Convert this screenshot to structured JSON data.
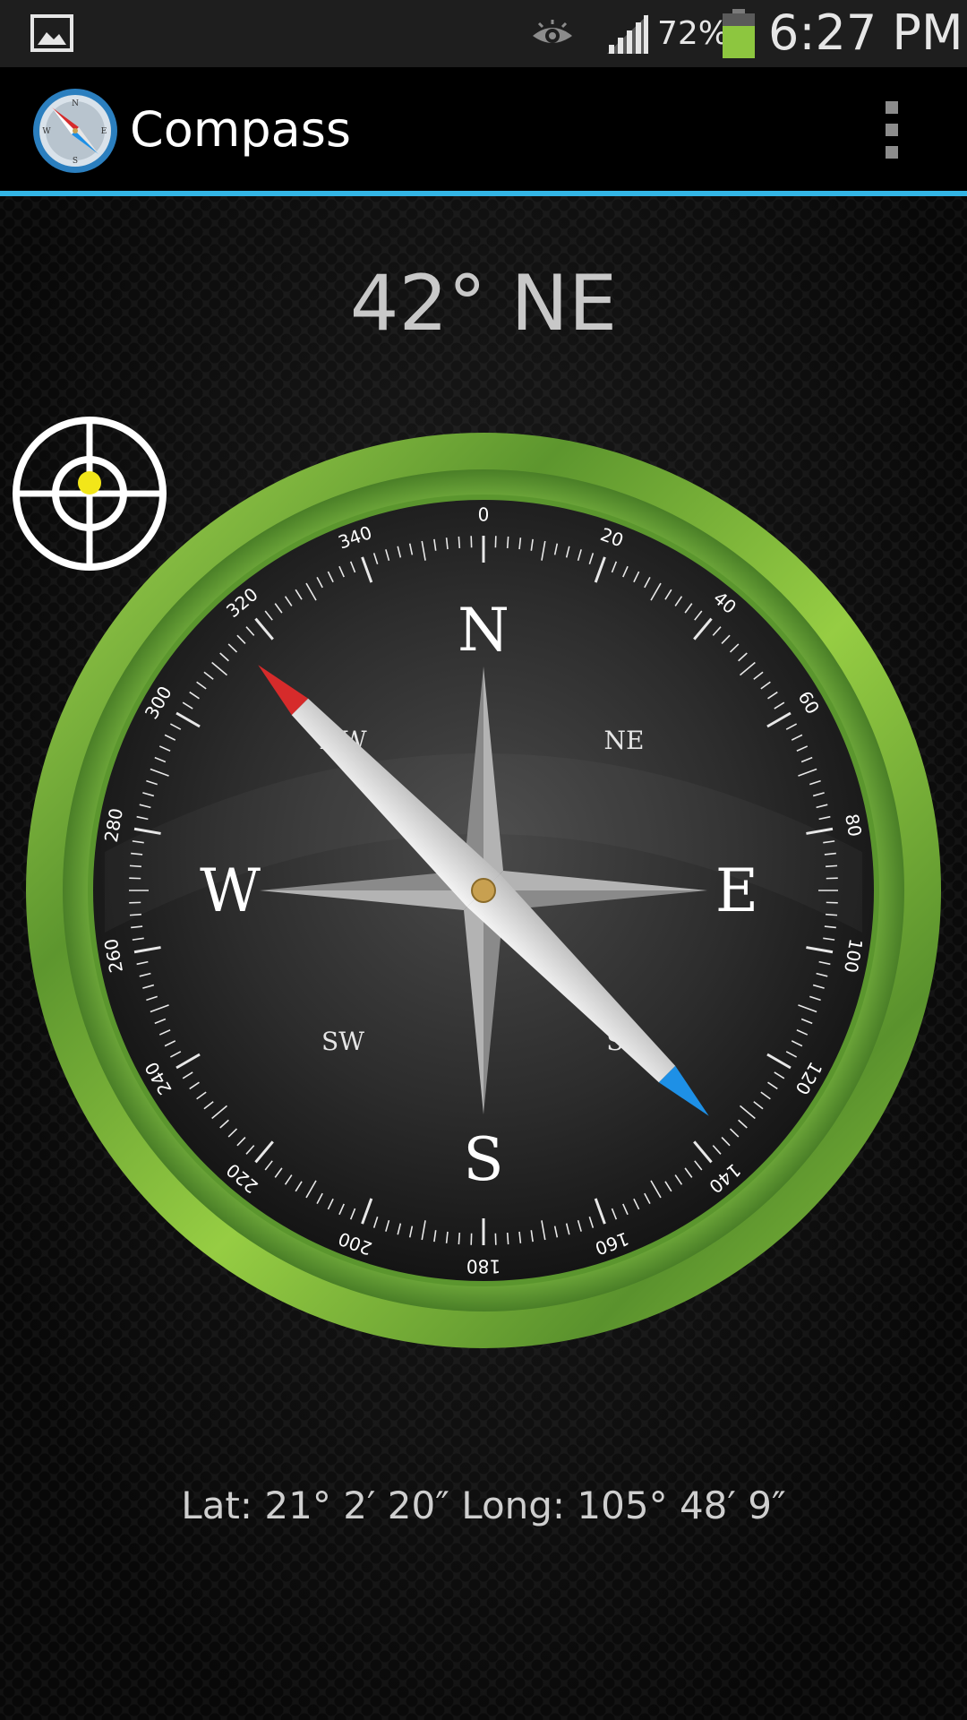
{
  "status_bar": {
    "notification_icon": "gallery-icon",
    "eye_icon": "eye-icon",
    "signal_icon": "signal-icon",
    "battery_percent": "72%",
    "battery_icon": "battery-icon",
    "battery_level": 0.72,
    "time": "6:27 PM"
  },
  "action_bar": {
    "app_icon": "compass-app-icon",
    "title": "Compass",
    "overflow_icon": "overflow-menu-icon",
    "accent_color": "#33b5e5"
  },
  "main": {
    "heading": "42° NE",
    "gps_icon": "crosshair-target-icon",
    "coordinates": "Lat: 21° 2′ 20″ Long: 105° 48′ 9″"
  },
  "compass": {
    "cardinals": {
      "n": "N",
      "e": "E",
      "s": "S",
      "w": "W"
    },
    "intercardinals": {
      "ne": "NE",
      "nw": "NW",
      "se": "SE",
      "sw": "SW"
    },
    "degree_labels": [
      "0",
      "20",
      "40",
      "60",
      "80",
      "100",
      "120",
      "140",
      "160",
      "180",
      "200",
      "220",
      "240",
      "260",
      "280",
      "300",
      "320",
      "340"
    ],
    "ring_color": "#8dc63f",
    "needle_north_color": "#d62b2b",
    "needle_south_color": "#1e90e6"
  }
}
